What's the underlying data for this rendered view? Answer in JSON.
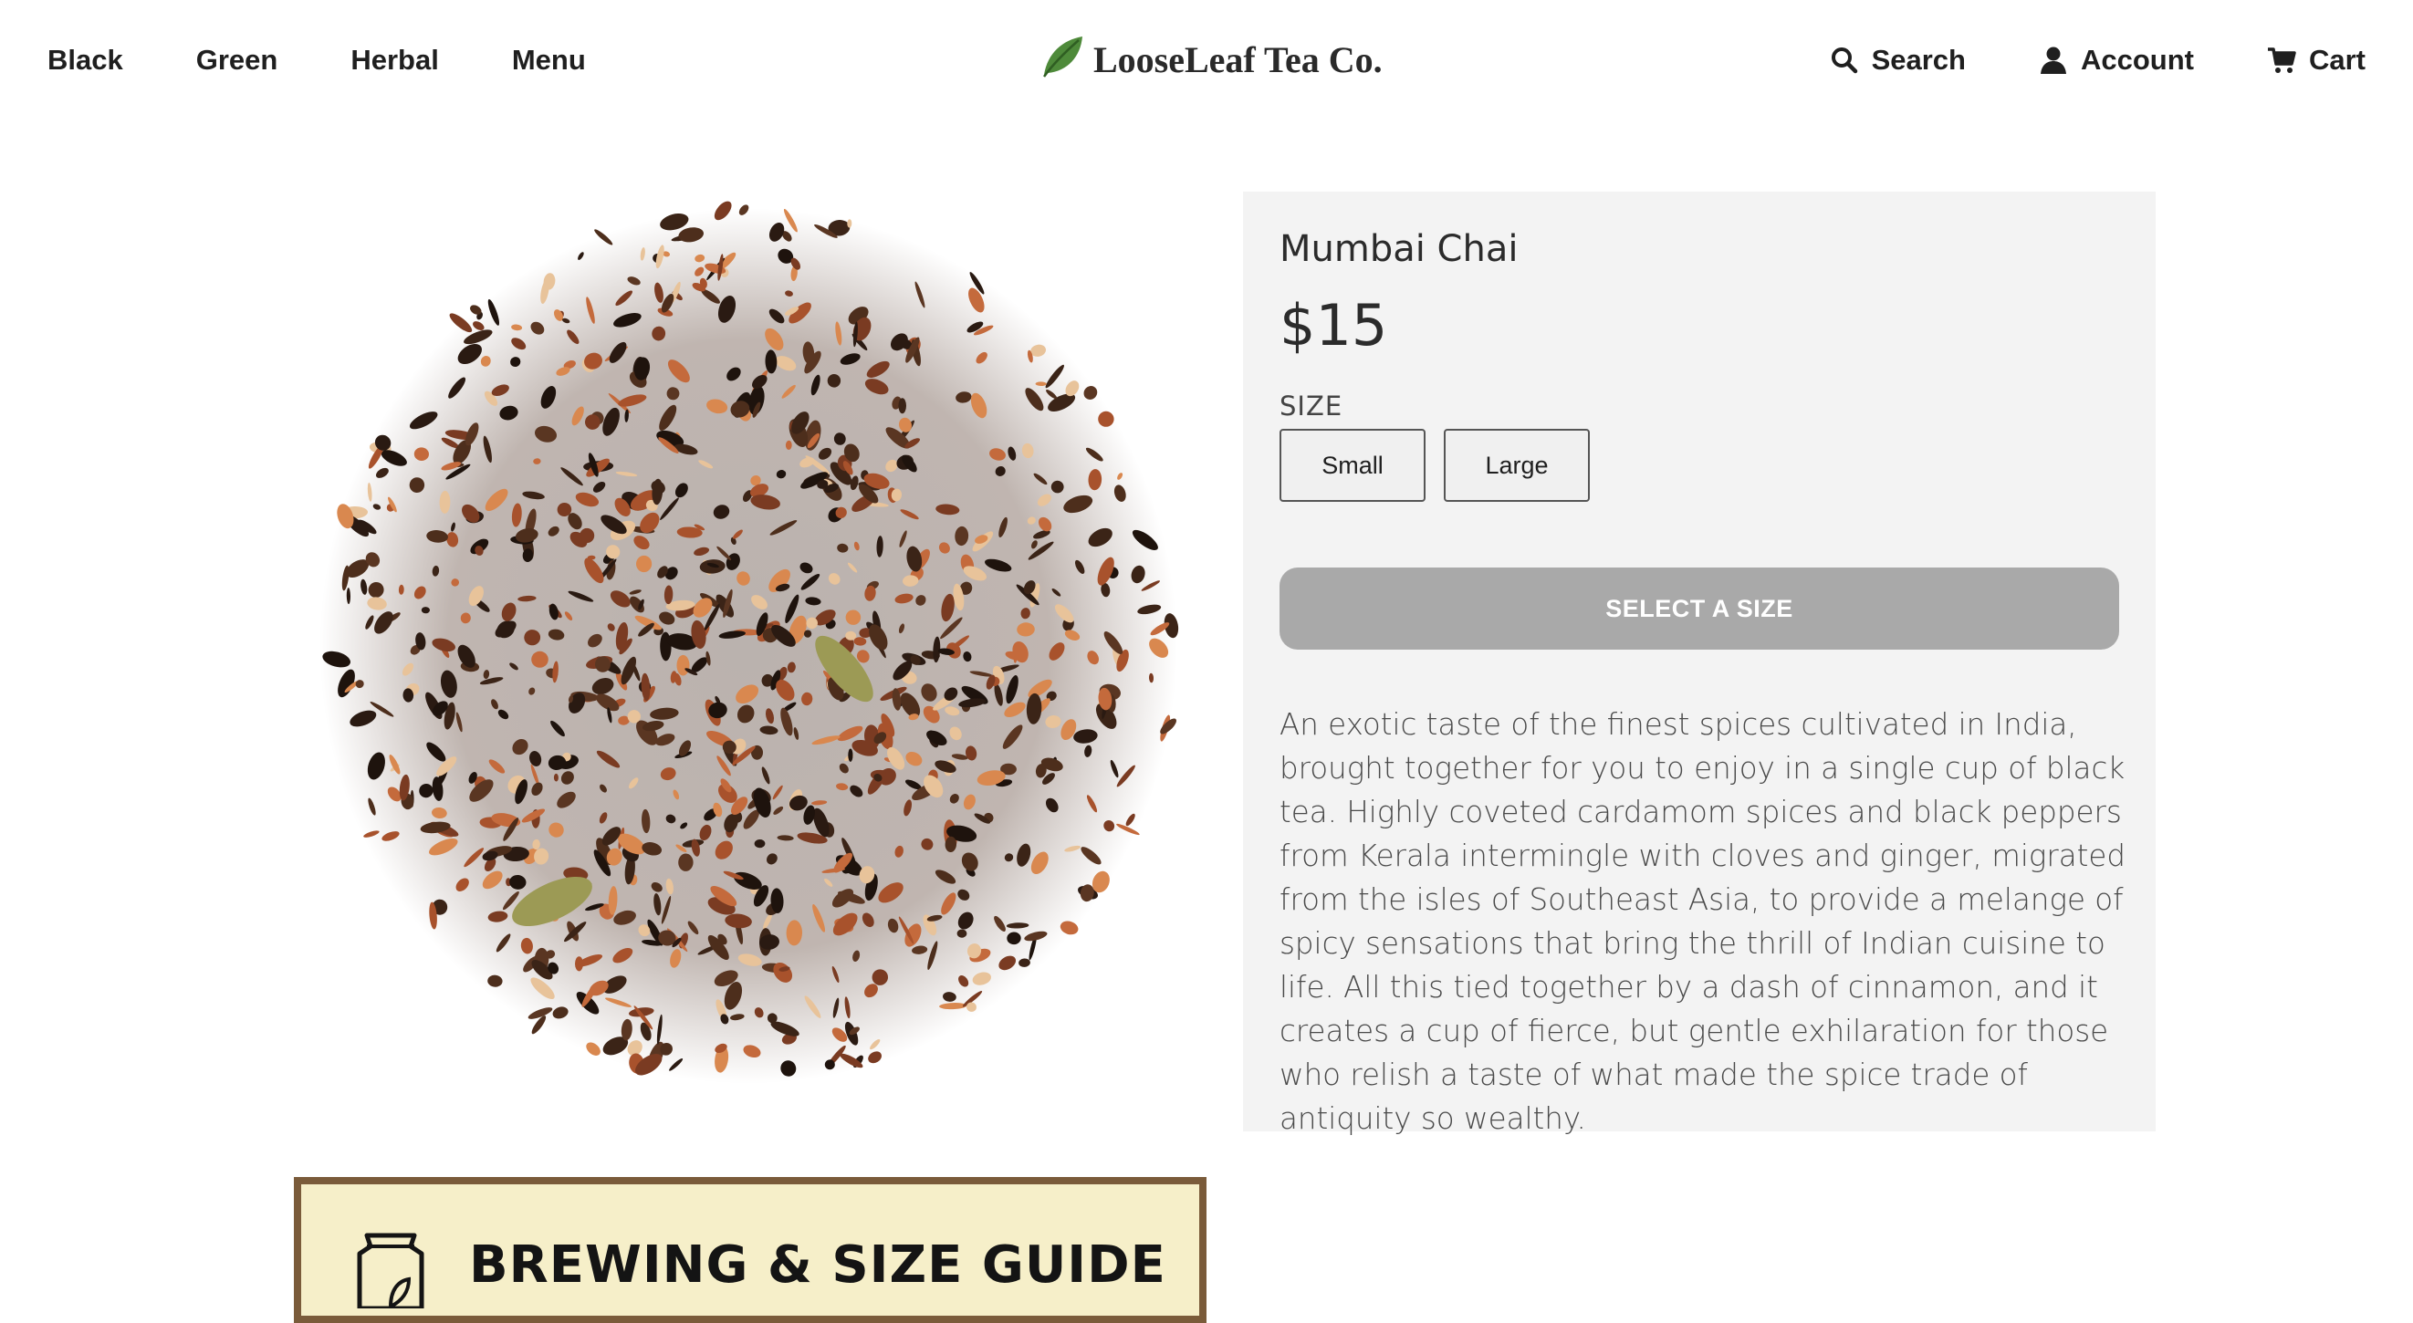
{
  "header": {
    "nav_left": [
      "Black",
      "Green",
      "Herbal",
      "Menu"
    ],
    "logo_text": "LooseLeaf Tea Co.",
    "search_label": "Search",
    "account_label": "Account",
    "cart_label": "Cart"
  },
  "product": {
    "title": "Mumbai Chai",
    "price": "$15",
    "size_label": "SIZE",
    "sizes": [
      "Small",
      "Large"
    ],
    "cta_label": "SELECT A SIZE",
    "description": "An exotic taste of the finest spices cultivated in India, brought together for you to enjoy in a single cup of black tea. Highly coveted cardamom spices and black peppers from Kerala intermingle with cloves and ginger, migrated from the isles of Southeast Asia, to provide a melange of spicy sensations that bring the thrill of Indian cuisine to life. All this tied together by a dash of cinnamon, and it creates a cup of fierce, but gentle exhilaration for those who relish a taste of what made the spice trade of antiquity so wealthy."
  },
  "guide": {
    "title": "BREWING & SIZE GUIDE"
  },
  "colors": {
    "panel_bg": "#f3f3f3",
    "cta_disabled": "#a9a9a9",
    "guide_bg": "#f6efc9",
    "guide_border": "#7a5b3a",
    "leaf_green": "#4e8a3a"
  },
  "icons": {
    "logo": "leaf-icon",
    "search": "search-icon",
    "account": "user-icon",
    "cart": "cart-icon",
    "guide": "tea-bag-icon"
  }
}
